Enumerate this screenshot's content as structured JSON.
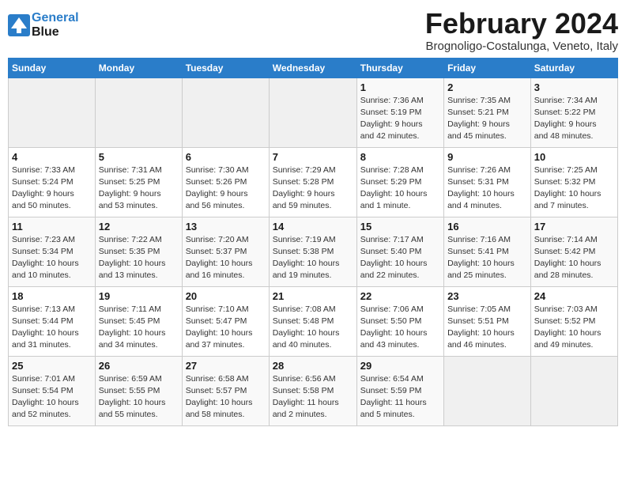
{
  "header": {
    "logo_line1": "General",
    "logo_line2": "Blue",
    "month": "February 2024",
    "location": "Brognoligo-Costalunga, Veneto, Italy"
  },
  "days_of_week": [
    "Sunday",
    "Monday",
    "Tuesday",
    "Wednesday",
    "Thursday",
    "Friday",
    "Saturday"
  ],
  "weeks": [
    [
      {
        "day": "",
        "info": ""
      },
      {
        "day": "",
        "info": ""
      },
      {
        "day": "",
        "info": ""
      },
      {
        "day": "",
        "info": ""
      },
      {
        "day": "1",
        "info": "Sunrise: 7:36 AM\nSunset: 5:19 PM\nDaylight: 9 hours\nand 42 minutes."
      },
      {
        "day": "2",
        "info": "Sunrise: 7:35 AM\nSunset: 5:21 PM\nDaylight: 9 hours\nand 45 minutes."
      },
      {
        "day": "3",
        "info": "Sunrise: 7:34 AM\nSunset: 5:22 PM\nDaylight: 9 hours\nand 48 minutes."
      }
    ],
    [
      {
        "day": "4",
        "info": "Sunrise: 7:33 AM\nSunset: 5:24 PM\nDaylight: 9 hours\nand 50 minutes."
      },
      {
        "day": "5",
        "info": "Sunrise: 7:31 AM\nSunset: 5:25 PM\nDaylight: 9 hours\nand 53 minutes."
      },
      {
        "day": "6",
        "info": "Sunrise: 7:30 AM\nSunset: 5:26 PM\nDaylight: 9 hours\nand 56 minutes."
      },
      {
        "day": "7",
        "info": "Sunrise: 7:29 AM\nSunset: 5:28 PM\nDaylight: 9 hours\nand 59 minutes."
      },
      {
        "day": "8",
        "info": "Sunrise: 7:28 AM\nSunset: 5:29 PM\nDaylight: 10 hours\nand 1 minute."
      },
      {
        "day": "9",
        "info": "Sunrise: 7:26 AM\nSunset: 5:31 PM\nDaylight: 10 hours\nand 4 minutes."
      },
      {
        "day": "10",
        "info": "Sunrise: 7:25 AM\nSunset: 5:32 PM\nDaylight: 10 hours\nand 7 minutes."
      }
    ],
    [
      {
        "day": "11",
        "info": "Sunrise: 7:23 AM\nSunset: 5:34 PM\nDaylight: 10 hours\nand 10 minutes."
      },
      {
        "day": "12",
        "info": "Sunrise: 7:22 AM\nSunset: 5:35 PM\nDaylight: 10 hours\nand 13 minutes."
      },
      {
        "day": "13",
        "info": "Sunrise: 7:20 AM\nSunset: 5:37 PM\nDaylight: 10 hours\nand 16 minutes."
      },
      {
        "day": "14",
        "info": "Sunrise: 7:19 AM\nSunset: 5:38 PM\nDaylight: 10 hours\nand 19 minutes."
      },
      {
        "day": "15",
        "info": "Sunrise: 7:17 AM\nSunset: 5:40 PM\nDaylight: 10 hours\nand 22 minutes."
      },
      {
        "day": "16",
        "info": "Sunrise: 7:16 AM\nSunset: 5:41 PM\nDaylight: 10 hours\nand 25 minutes."
      },
      {
        "day": "17",
        "info": "Sunrise: 7:14 AM\nSunset: 5:42 PM\nDaylight: 10 hours\nand 28 minutes."
      }
    ],
    [
      {
        "day": "18",
        "info": "Sunrise: 7:13 AM\nSunset: 5:44 PM\nDaylight: 10 hours\nand 31 minutes."
      },
      {
        "day": "19",
        "info": "Sunrise: 7:11 AM\nSunset: 5:45 PM\nDaylight: 10 hours\nand 34 minutes."
      },
      {
        "day": "20",
        "info": "Sunrise: 7:10 AM\nSunset: 5:47 PM\nDaylight: 10 hours\nand 37 minutes."
      },
      {
        "day": "21",
        "info": "Sunrise: 7:08 AM\nSunset: 5:48 PM\nDaylight: 10 hours\nand 40 minutes."
      },
      {
        "day": "22",
        "info": "Sunrise: 7:06 AM\nSunset: 5:50 PM\nDaylight: 10 hours\nand 43 minutes."
      },
      {
        "day": "23",
        "info": "Sunrise: 7:05 AM\nSunset: 5:51 PM\nDaylight: 10 hours\nand 46 minutes."
      },
      {
        "day": "24",
        "info": "Sunrise: 7:03 AM\nSunset: 5:52 PM\nDaylight: 10 hours\nand 49 minutes."
      }
    ],
    [
      {
        "day": "25",
        "info": "Sunrise: 7:01 AM\nSunset: 5:54 PM\nDaylight: 10 hours\nand 52 minutes."
      },
      {
        "day": "26",
        "info": "Sunrise: 6:59 AM\nSunset: 5:55 PM\nDaylight: 10 hours\nand 55 minutes."
      },
      {
        "day": "27",
        "info": "Sunrise: 6:58 AM\nSunset: 5:57 PM\nDaylight: 10 hours\nand 58 minutes."
      },
      {
        "day": "28",
        "info": "Sunrise: 6:56 AM\nSunset: 5:58 PM\nDaylight: 11 hours\nand 2 minutes."
      },
      {
        "day": "29",
        "info": "Sunrise: 6:54 AM\nSunset: 5:59 PM\nDaylight: 11 hours\nand 5 minutes."
      },
      {
        "day": "",
        "info": ""
      },
      {
        "day": "",
        "info": ""
      }
    ]
  ]
}
